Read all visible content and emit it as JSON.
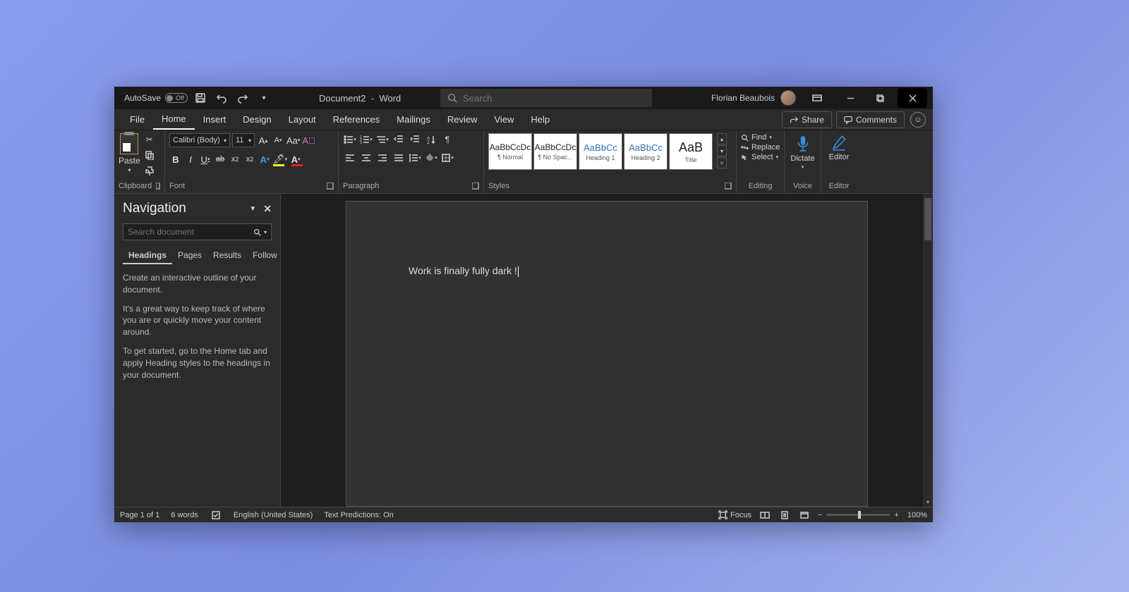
{
  "titlebar": {
    "autosave_label": "AutoSave",
    "autosave_state": "Off",
    "doc_name": "Document2",
    "app_name": "Word",
    "search_placeholder": "Search",
    "user_name": "Florian Beaubois"
  },
  "tabs": [
    "File",
    "Home",
    "Insert",
    "Design",
    "Layout",
    "References",
    "Mailings",
    "Review",
    "View",
    "Help"
  ],
  "active_tab": "Home",
  "share_label": "Share",
  "comments_label": "Comments",
  "ribbon": {
    "clipboard": {
      "paste": "Paste",
      "label": "Clipboard"
    },
    "font": {
      "name": "Calibri (Body)",
      "size": "11",
      "label": "Font"
    },
    "paragraph": {
      "label": "Paragraph"
    },
    "styles": {
      "items": [
        {
          "preview": "AaBbCcDc",
          "name": "¶ Normal"
        },
        {
          "preview": "AaBbCcDc",
          "name": "¶ No Spac..."
        },
        {
          "preview": "AaBbCc",
          "name": "Heading 1"
        },
        {
          "preview": "AaBbCc",
          "name": "Heading 2"
        },
        {
          "preview": "AaB",
          "name": "Title"
        }
      ],
      "label": "Styles"
    },
    "editing": {
      "find": "Find",
      "replace": "Replace",
      "select": "Select",
      "label": "Editing"
    },
    "voice": {
      "dictate": "Dictate",
      "label": "Voice"
    },
    "editor": {
      "editor": "Editor",
      "label": "Editor"
    }
  },
  "nav": {
    "title": "Navigation",
    "search_placeholder": "Search document",
    "tabs": [
      "Headings",
      "Pages",
      "Results",
      "Follow"
    ],
    "active": "Headings",
    "hint1": "Create an interactive outline of your document.",
    "hint2": "It's a great way to keep track of where you are or quickly move your content around.",
    "hint3": "To get started, go to the Home tab and apply Heading styles to the headings in your document."
  },
  "document": {
    "text": "Work is finally fully dark !"
  },
  "status": {
    "page": "Page 1 of 1",
    "words": "6 words",
    "language": "English (United States)",
    "predictions": "Text Predictions: On",
    "focus": "Focus",
    "zoom": "100%"
  }
}
